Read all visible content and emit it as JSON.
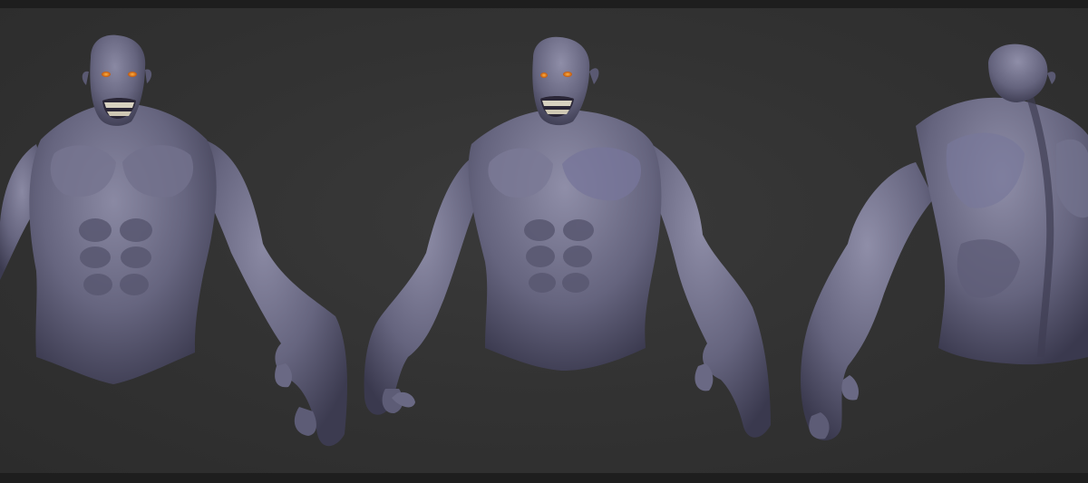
{
  "scene": {
    "subject": "",
    "views": [
      {
        "id": "front",
        "icon": "creature-bust-front-icon"
      },
      {
        "id": "three-quarter",
        "icon": "creature-bust-three-quarter-icon"
      },
      {
        "id": "back",
        "icon": "creature-bust-back-icon"
      }
    ]
  },
  "colors": {
    "background": "#333333",
    "border": "#1e1e1e",
    "skin": "#6b6a86",
    "skin_shadow": "#3f3e55",
    "skin_highlight": "#8d8ca6",
    "eyes": "#e07a1a",
    "teeth": "#d8d2c0"
  }
}
